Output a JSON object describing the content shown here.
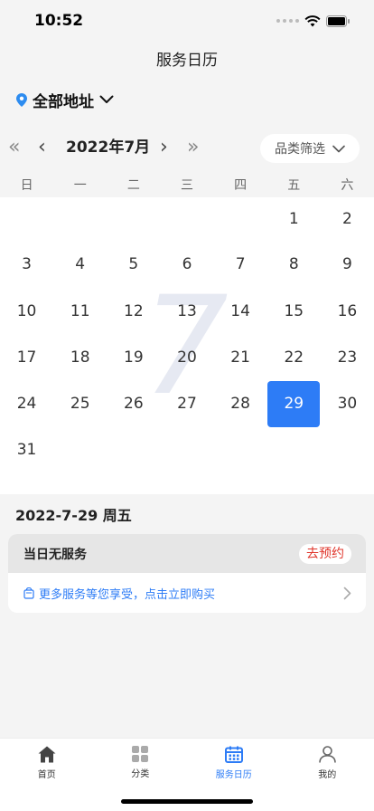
{
  "status": {
    "time": "10:52"
  },
  "header": {
    "title": "服务日历"
  },
  "address": {
    "label": "全部地址"
  },
  "calendar": {
    "month_label": "2022年7月",
    "filter_label": "品类筛选",
    "big_month": "7",
    "weekdays": [
      "日",
      "一",
      "二",
      "三",
      "四",
      "五",
      "六"
    ],
    "selected_day": "29"
  },
  "selection": {
    "date_heading": "2022-7-29 周五",
    "no_service": "当日无服务",
    "book_label": "去预约",
    "promo": "更多服务等您享受，点击立即购买"
  },
  "tabs": [
    {
      "label": "首页",
      "icon": "home-icon"
    },
    {
      "label": "分类",
      "icon": "grid-icon"
    },
    {
      "label": "服务日历",
      "icon": "calendar-icon",
      "active": true
    },
    {
      "label": "我的",
      "icon": "user-icon"
    }
  ],
  "colors": {
    "accent": "#2d7cf6",
    "alert": "#e0352b"
  }
}
